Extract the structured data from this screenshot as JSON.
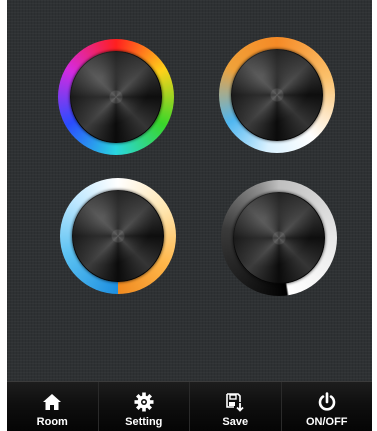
{
  "wheels": [
    {
      "id": "rgb",
      "name": "rgb-color-wheel"
    },
    {
      "id": "warm",
      "name": "warm-color-wheel"
    },
    {
      "id": "cct",
      "name": "color-temperature-wheel"
    },
    {
      "id": "dim",
      "name": "dimmer-wheel"
    }
  ],
  "nav": {
    "room": {
      "label": "Room",
      "icon": "home-icon"
    },
    "setting": {
      "label": "Setting",
      "icon": "gear-icon"
    },
    "save": {
      "label": "Save",
      "icon": "save-icon"
    },
    "onoff": {
      "label": "ON/OFF",
      "icon": "power-icon"
    }
  },
  "colors": {
    "background": "#2e3133",
    "nav_background": "#0f0f0f",
    "nav_text": "#ffffff"
  }
}
